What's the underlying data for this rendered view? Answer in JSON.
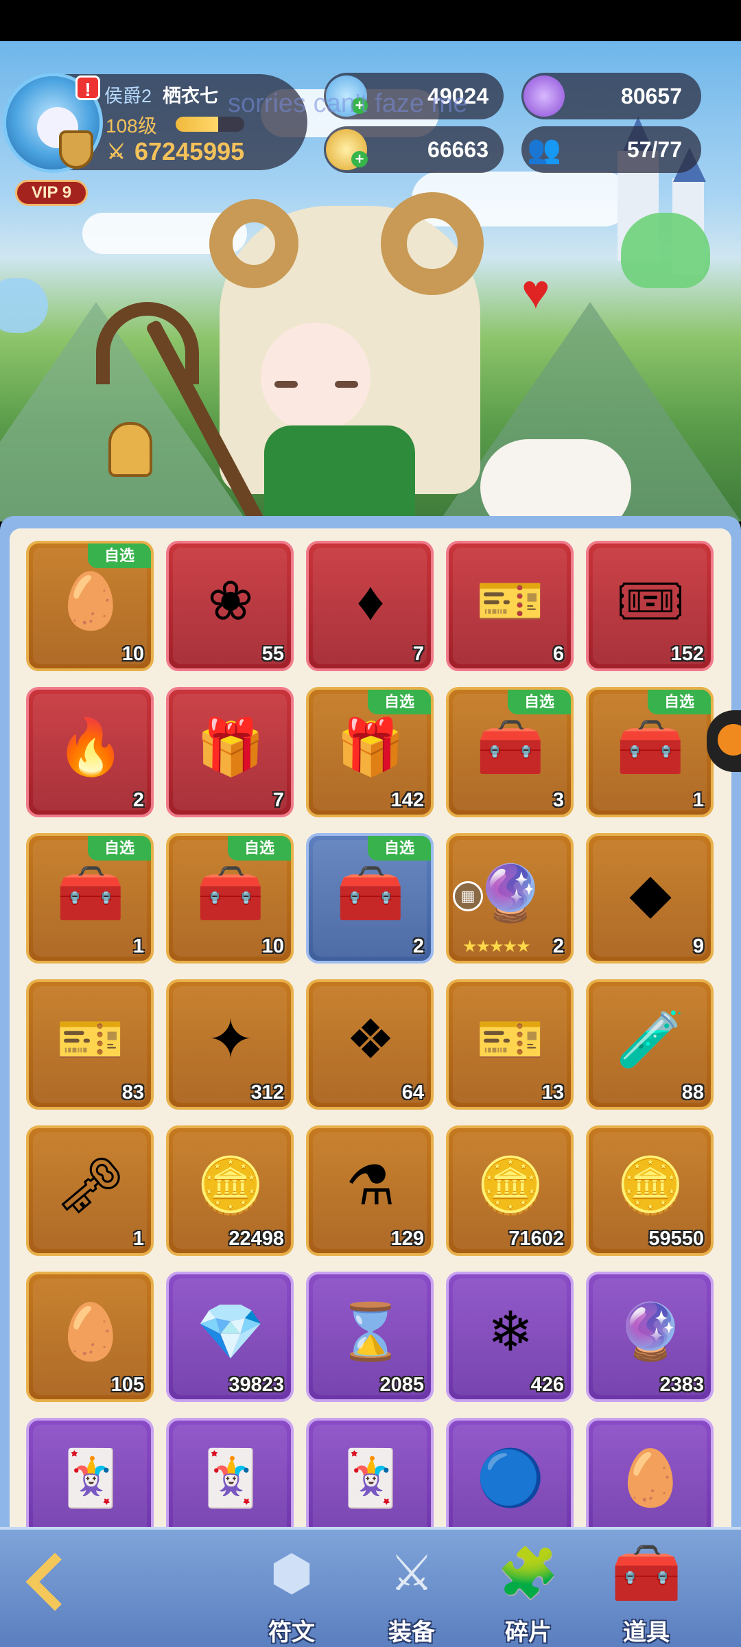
{
  "player": {
    "title": "侯爵2",
    "name": "栖衣七",
    "level": "108级",
    "exp_fraction": 0.62,
    "power": "67245995",
    "vip": "VIP 9"
  },
  "resources": {
    "stars": "49024",
    "purple_currency": "80657",
    "gold": "66663",
    "friends": "57/77"
  },
  "watermark": "sorries can't faze me",
  "select_tag": "自选",
  "items": [
    {
      "icon": "fire-egg-bowl-icon",
      "glyph": "🥚",
      "rarity": "gold",
      "count": "10",
      "tag": true
    },
    {
      "icon": "crystal-flower-icon",
      "glyph": "❀",
      "rarity": "red",
      "count": "55",
      "tag": false
    },
    {
      "icon": "red-gem-icon",
      "glyph": "♦",
      "rarity": "red",
      "count": "7",
      "tag": false
    },
    {
      "icon": "blue-ticket-icon",
      "glyph": "🎫",
      "rarity": "red",
      "count": "6",
      "tag": false
    },
    {
      "icon": "gold-ticket-icon",
      "glyph": "🎟",
      "rarity": "red",
      "count": "152",
      "tag": false
    },
    {
      "icon": "flame-egg-icon",
      "glyph": "🔥",
      "rarity": "red",
      "count": "2",
      "tag": false
    },
    {
      "icon": "mystery-chest-icon",
      "glyph": "🎁",
      "rarity": "red",
      "count": "7",
      "tag": false
    },
    {
      "icon": "gem-giftbox-icon",
      "glyph": "🎁",
      "rarity": "gold",
      "count": "142",
      "tag": true
    },
    {
      "icon": "orb-chest-icon",
      "glyph": "🧰",
      "rarity": "gold",
      "count": "3",
      "tag": true
    },
    {
      "icon": "crystal-chest-icon",
      "glyph": "🧰",
      "rarity": "gold",
      "count": "1",
      "tag": true
    },
    {
      "icon": "purple-gem-chest-icon",
      "glyph": "🧰",
      "rarity": "gold",
      "count": "1",
      "tag": true
    },
    {
      "icon": "golden-chest-icon",
      "glyph": "🧰",
      "rarity": "gold",
      "count": "10",
      "tag": true
    },
    {
      "icon": "blue-chest-icon",
      "glyph": "🧰",
      "rarity": "blue",
      "count": "2",
      "tag": true
    },
    {
      "icon": "golden-orb-icon",
      "glyph": "🔮",
      "rarity": "gold",
      "count": "2",
      "tag": false,
      "stars": "★★★★★",
      "grid_button": true
    },
    {
      "icon": "amber-gem-icon",
      "glyph": "◆",
      "rarity": "gold",
      "count": "9",
      "tag": false
    },
    {
      "icon": "coupon-ticket-icon",
      "glyph": "🎫",
      "rarity": "gold",
      "count": "83",
      "tag": false
    },
    {
      "icon": "blue-star-crystal-icon",
      "glyph": "✦",
      "rarity": "gold",
      "count": "312",
      "tag": false
    },
    {
      "icon": "green-crystal-icon",
      "glyph": "❖",
      "rarity": "gold",
      "count": "64",
      "tag": false
    },
    {
      "icon": "heart-ticket-icon",
      "glyph": "🎫",
      "rarity": "gold",
      "count": "13",
      "tag": false
    },
    {
      "icon": "rainbow-vial-icon",
      "glyph": "🧪",
      "rarity": "gold",
      "count": "88",
      "tag": false
    },
    {
      "icon": "golden-key-icon",
      "glyph": "🗝",
      "rarity": "gold",
      "count": "1",
      "tag": false
    },
    {
      "icon": "silver-coin-icon",
      "glyph": "🪙",
      "rarity": "gold",
      "count": "22498",
      "tag": false
    },
    {
      "icon": "lightning-potion-icon",
      "glyph": "⚗",
      "rarity": "gold",
      "count": "129",
      "tag": false
    },
    {
      "icon": "gold-coin-icon",
      "glyph": "🪙",
      "rarity": "gold",
      "count": "71602",
      "tag": false
    },
    {
      "icon": "purple-coin-icon",
      "glyph": "🪙",
      "rarity": "gold",
      "count": "59550",
      "tag": false
    },
    {
      "icon": "dragon-egg-icon",
      "glyph": "🥚",
      "rarity": "gold",
      "count": "105",
      "tag": false
    },
    {
      "icon": "diamond-crystal-icon",
      "glyph": "💎",
      "rarity": "purple",
      "count": "39823",
      "tag": false
    },
    {
      "icon": "hourglass-icon",
      "glyph": "⌛",
      "rarity": "purple",
      "count": "2085",
      "tag": false
    },
    {
      "icon": "ice-crystal-icon",
      "glyph": "❄",
      "rarity": "purple",
      "count": "426",
      "tag": false
    },
    {
      "icon": "purple-orb-ring-icon",
      "glyph": "🔮",
      "rarity": "purple",
      "count": "2383",
      "tag": false
    },
    {
      "icon": "sword-card-icon",
      "glyph": "🃏",
      "rarity": "purple",
      "count": "",
      "tag": false
    },
    {
      "icon": "armor-card-icon",
      "glyph": "🃏",
      "rarity": "purple",
      "count": "",
      "tag": false
    },
    {
      "icon": "refresh-card-icon",
      "glyph": "🃏",
      "rarity": "purple",
      "count": "",
      "tag": false
    },
    {
      "icon": "teal-orb-icon",
      "glyph": "🔵",
      "rarity": "purple",
      "count": "",
      "tag": false
    },
    {
      "icon": "purple-egg-icon",
      "glyph": "🥚",
      "rarity": "purple",
      "count": "",
      "tag": false
    }
  ],
  "nav": [
    {
      "key": "runes",
      "label": "符文",
      "icon": "rune-icon",
      "glyph": "⬢",
      "color": "#cfe0f7",
      "active": false
    },
    {
      "key": "equipment",
      "label": "装备",
      "icon": "crossed-swords-icon",
      "glyph": "⚔",
      "color": "#dfe8f5",
      "active": false
    },
    {
      "key": "fragments",
      "label": "碎片",
      "icon": "puzzle-piece-icon",
      "glyph": "🧩",
      "color": "#dfe8f5",
      "active": false
    },
    {
      "key": "items",
      "label": "道具",
      "icon": "treasure-chest-icon",
      "glyph": "🧰",
      "color": "#f4c75a",
      "active": true
    }
  ],
  "colors": {
    "gold_tile": "#b96c1b",
    "red_tile": "#b42a32",
    "purple_tile": "#7a40b8",
    "blue_tile": "#4d6fad",
    "select_tag": "#38b24c",
    "power_gold": "#f4c25a"
  }
}
